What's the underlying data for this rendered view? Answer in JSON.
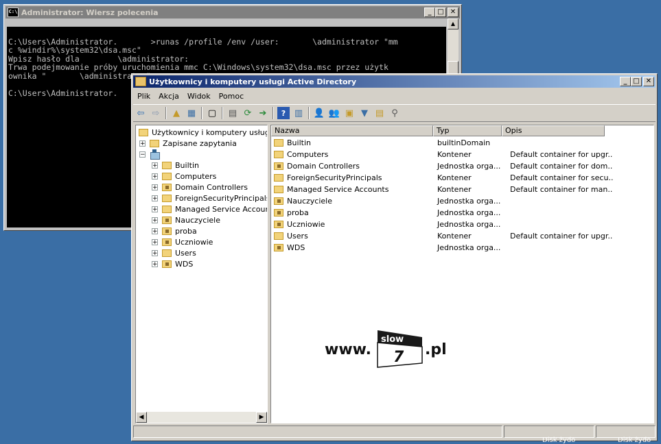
{
  "cmd_window": {
    "title": "Administrator: Wiersz polecenia",
    "icon_text": "C:\\",
    "lines": [
      "",
      "C:\\Users\\Administrator.       >runas /profile /env /user:       \\administrator \"mm",
      "c %windir%\\system32\\dsa.msc\"",
      "Wpisz hasło dla        \\administrator:",
      "Trwa podejmowanie próby uruchomienia mmc C:\\Windows\\system32\\dsa.msc przez użytk",
      "ownika \"       \\administrator\" ...",
      "",
      "C:\\Users\\Administrator."
    ]
  },
  "ad_window": {
    "title": "Użytkownicy i komputery usługi Active Directory",
    "menu": [
      "Plik",
      "Akcja",
      "Widok",
      "Pomoc"
    ],
    "tree": {
      "root": "Użytkownicy i komputery usługi Act",
      "saved_queries": "Zapisane zapytania",
      "children": [
        "Builtin",
        "Computers",
        "Domain Controllers",
        "ForeignSecurityPrincipals",
        "Managed Service Accounts",
        "Nauczyciele",
        "proba",
        "Uczniowie",
        "Users",
        "WDS"
      ]
    },
    "columns": [
      "Nazwa",
      "Typ",
      "Opis"
    ],
    "rows": [
      {
        "name": "Builtin",
        "type": "builtinDomain",
        "desc": ""
      },
      {
        "name": "Computers",
        "type": "Kontener",
        "desc": "Default container for upgr..."
      },
      {
        "name": "Domain Controllers",
        "type": "Jednostka orga...",
        "desc": "Default container for dom..."
      },
      {
        "name": "ForeignSecurityPrincipals",
        "type": "Kontener",
        "desc": "Default container for secu..."
      },
      {
        "name": "Managed Service Accounts",
        "type": "Kontener",
        "desc": "Default container for man..."
      },
      {
        "name": "Nauczyciele",
        "type": "Jednostka orga...",
        "desc": ""
      },
      {
        "name": "proba",
        "type": "Jednostka orga...",
        "desc": ""
      },
      {
        "name": "Uczniowie",
        "type": "Jednostka orga...",
        "desc": ""
      },
      {
        "name": "Users",
        "type": "Kontener",
        "desc": "Default container for upgr..."
      },
      {
        "name": "WDS",
        "type": "Jednostka orga...",
        "desc": ""
      }
    ]
  },
  "watermark": {
    "prefix": "www.",
    "top": "slow",
    "number": "7",
    "suffix": ".pl"
  },
  "desktop": {
    "label1": "Disk żydo",
    "label2": "Disk żydo"
  }
}
